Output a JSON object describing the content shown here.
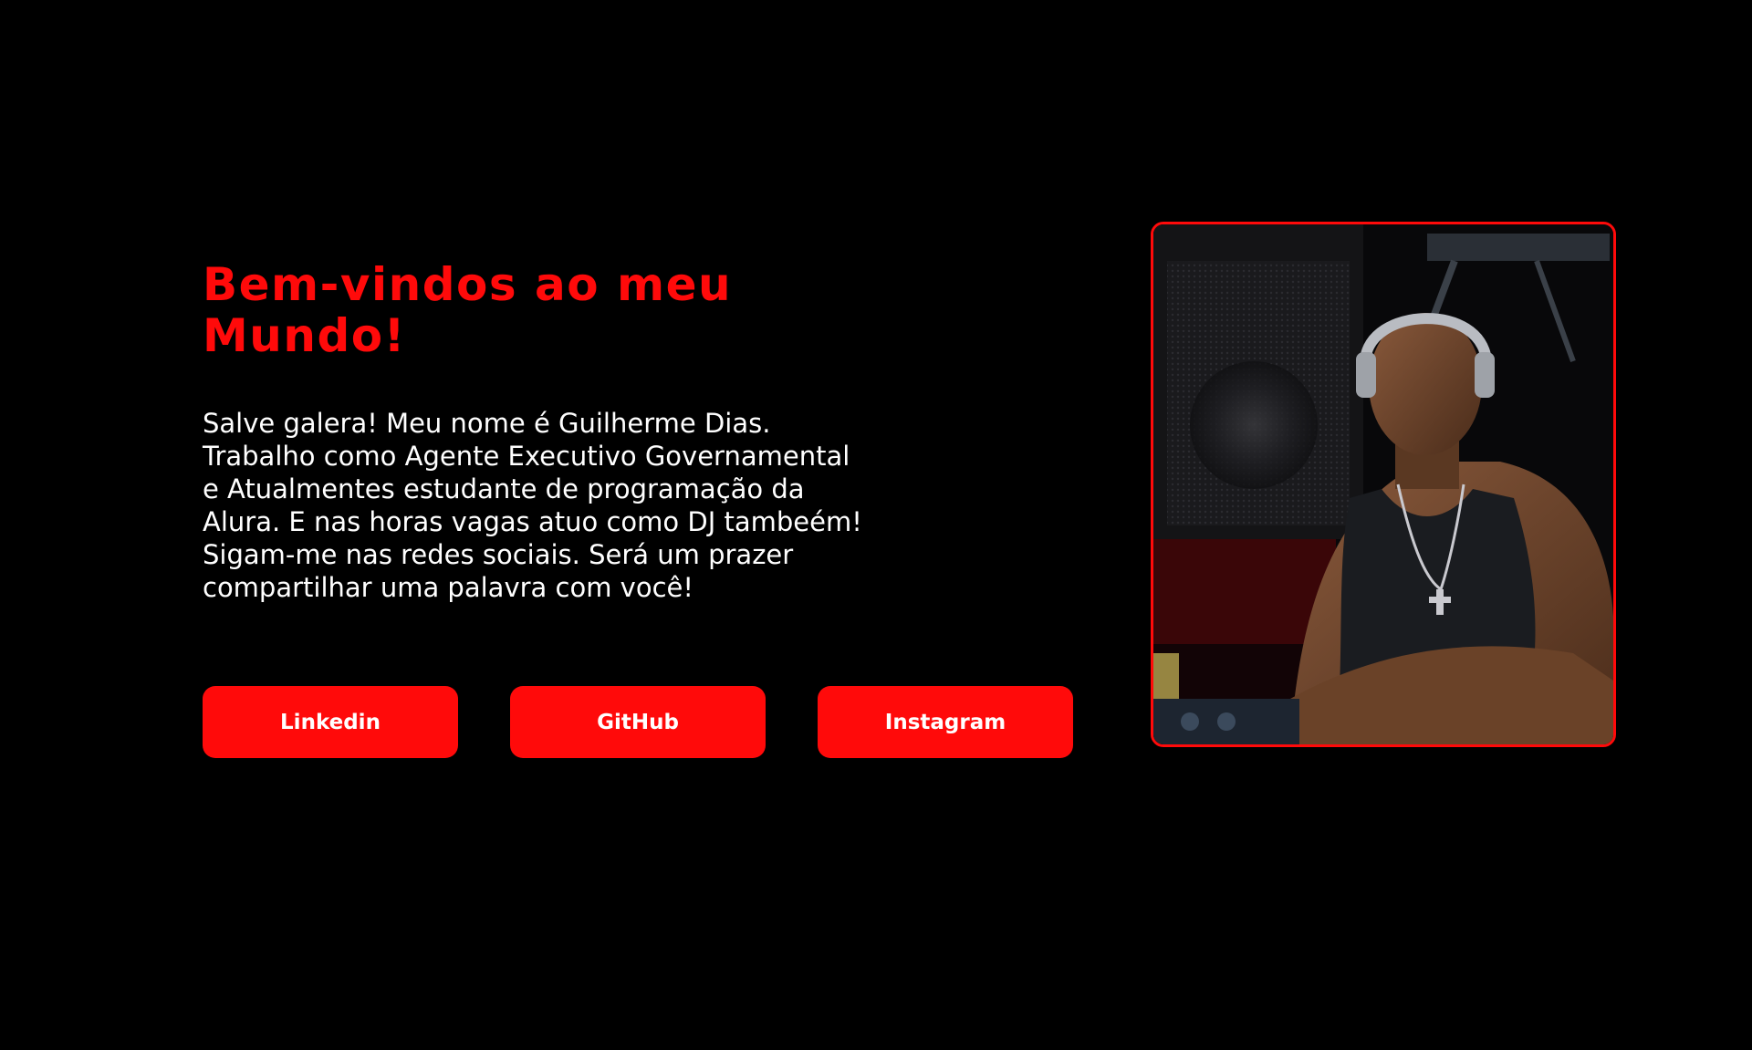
{
  "hero": {
    "title_line1": "Bem-vindos ao meu",
    "title_line2": "Mundo!",
    "bio_lines": [
      "Salve galera! Meu nome é Guilherme Dias.",
      "Trabalho como Agente Executivo Governamental",
      "e Atualmentes estudante de programação da",
      "Alura. E nas horas vagas atuo como DJ tambeém!",
      "Sigam-me nas redes sociais. Será um prazer",
      "compartilhar uma palavra com você!"
    ]
  },
  "social_buttons": [
    {
      "label": "Linkedin"
    },
    {
      "label": "GitHub"
    },
    {
      "label": "Instagram"
    }
  ],
  "colors": {
    "accent": "#ff0a0a",
    "background": "#000000",
    "text": "#ffffff"
  }
}
